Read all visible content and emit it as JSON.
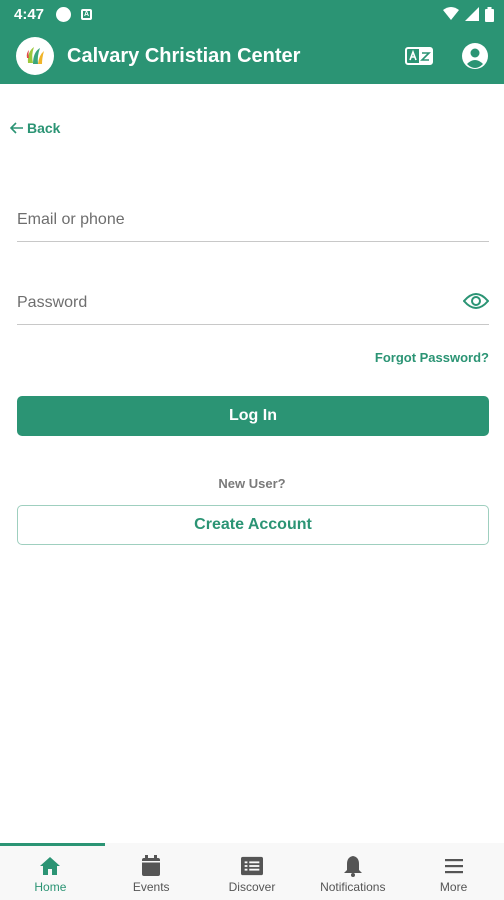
{
  "status_bar": {
    "time": "4:47"
  },
  "app_bar": {
    "title": "Calvary Christian Center"
  },
  "back": {
    "label": "Back"
  },
  "login_form": {
    "email_placeholder": "Email or phone",
    "password_placeholder": "Password",
    "forgot_label": "Forgot Password?",
    "login_label": "Log In",
    "new_user_label": "New User?",
    "create_account_label": "Create Account"
  },
  "bottom_nav": {
    "items": [
      {
        "label": "Home",
        "icon": "home-icon",
        "active": true
      },
      {
        "label": "Events",
        "icon": "calendar-icon"
      },
      {
        "label": "Discover",
        "icon": "list-icon"
      },
      {
        "label": "Notifications",
        "icon": "bell-icon"
      },
      {
        "label": "More",
        "icon": "menu-icon"
      }
    ]
  },
  "colors": {
    "brand": "#2b9474",
    "text": "#333333",
    "muted": "#7a7a7a"
  }
}
